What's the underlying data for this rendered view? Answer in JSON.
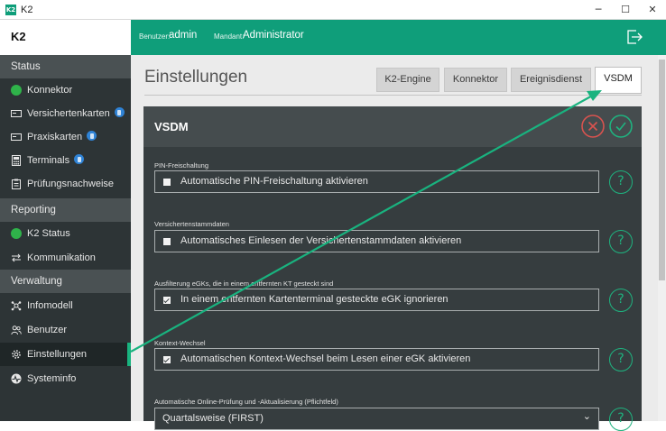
{
  "window": {
    "icon_text": "K2",
    "title": "K2",
    "minimize": "─",
    "maximize": "☐",
    "close": "✕"
  },
  "brand": "K2",
  "header": {
    "user_label": "Benutzer:",
    "user_value": "admin",
    "tenant_label": "Mandant:",
    "tenant_value": "Administrator",
    "logout_icon": "logout-icon"
  },
  "sidebar": {
    "status_title": "Status",
    "status_items": [
      {
        "label": "Konnektor",
        "icon": "status-dot"
      },
      {
        "label": "Versichertenkarten",
        "icon": "card-icon",
        "badge": true
      },
      {
        "label": "Praxiskarten",
        "icon": "card-icon",
        "badge": true
      },
      {
        "label": "Terminals",
        "icon": "terminal-icon",
        "badge": true
      },
      {
        "label": "Prüfungsnachweise",
        "icon": "clipboard-icon"
      }
    ],
    "reporting_title": "Reporting",
    "reporting_items": [
      {
        "label": "K2 Status",
        "icon": "status-dot"
      },
      {
        "label": "Kommunikation",
        "icon": "exchange-icon"
      }
    ],
    "admin_title": "Verwaltung",
    "admin_items": [
      {
        "label": "Infomodell",
        "icon": "network-icon"
      },
      {
        "label": "Benutzer",
        "icon": "users-icon"
      },
      {
        "label": "Einstellungen",
        "icon": "gear-icon",
        "active": true
      },
      {
        "label": "Systeminfo",
        "icon": "pulse-icon"
      }
    ]
  },
  "page": {
    "title": "Einstellungen",
    "tabs": [
      {
        "label": "K2-Engine",
        "active": false
      },
      {
        "label": "Konnektor",
        "active": false
      },
      {
        "label": "Ereignisdienst",
        "active": false
      },
      {
        "label": "VSDM",
        "active": true
      }
    ]
  },
  "panel": {
    "title": "VSDM",
    "cancel_icon": "cancel-icon",
    "confirm_icon": "confirm-icon",
    "fields": [
      {
        "label": "PIN-Freischaltung",
        "text": "Automatische PIN-Freischaltung aktivieren",
        "checked": false
      },
      {
        "label": "Versichertenstammdaten",
        "text": "Automatisches Einlesen der Versichertenstammdaten aktivieren",
        "checked": false
      },
      {
        "label": "Ausfilterung eGKs, die in einem entfernten KT gesteckt sind",
        "text": "In einem entfernten Kartenterminal gesteckte eGK ignorieren",
        "checked": true
      },
      {
        "label": "Kontext-Wechsel",
        "text": "Automatischen Kontext-Wechsel beim Lesen einer eGK aktivieren",
        "checked": true
      },
      {
        "label": "Automatische Online-Prüfung und -Aktualisierung (Pflichtfeld)",
        "text": "Quartalsweise (FIRST)",
        "dropdown": true
      }
    ],
    "help_glyph": "?",
    "dropdown_glyph": "⌄"
  },
  "colors": {
    "accent": "#0f9e7a",
    "sidebar_bg": "#2d3436",
    "panel_bg": "#363d3f",
    "help_ring": "#1fb27f",
    "cancel_red": "#d9534f",
    "confirm_green": "#1fb27f",
    "annotation_arrow": "#19b37f"
  }
}
